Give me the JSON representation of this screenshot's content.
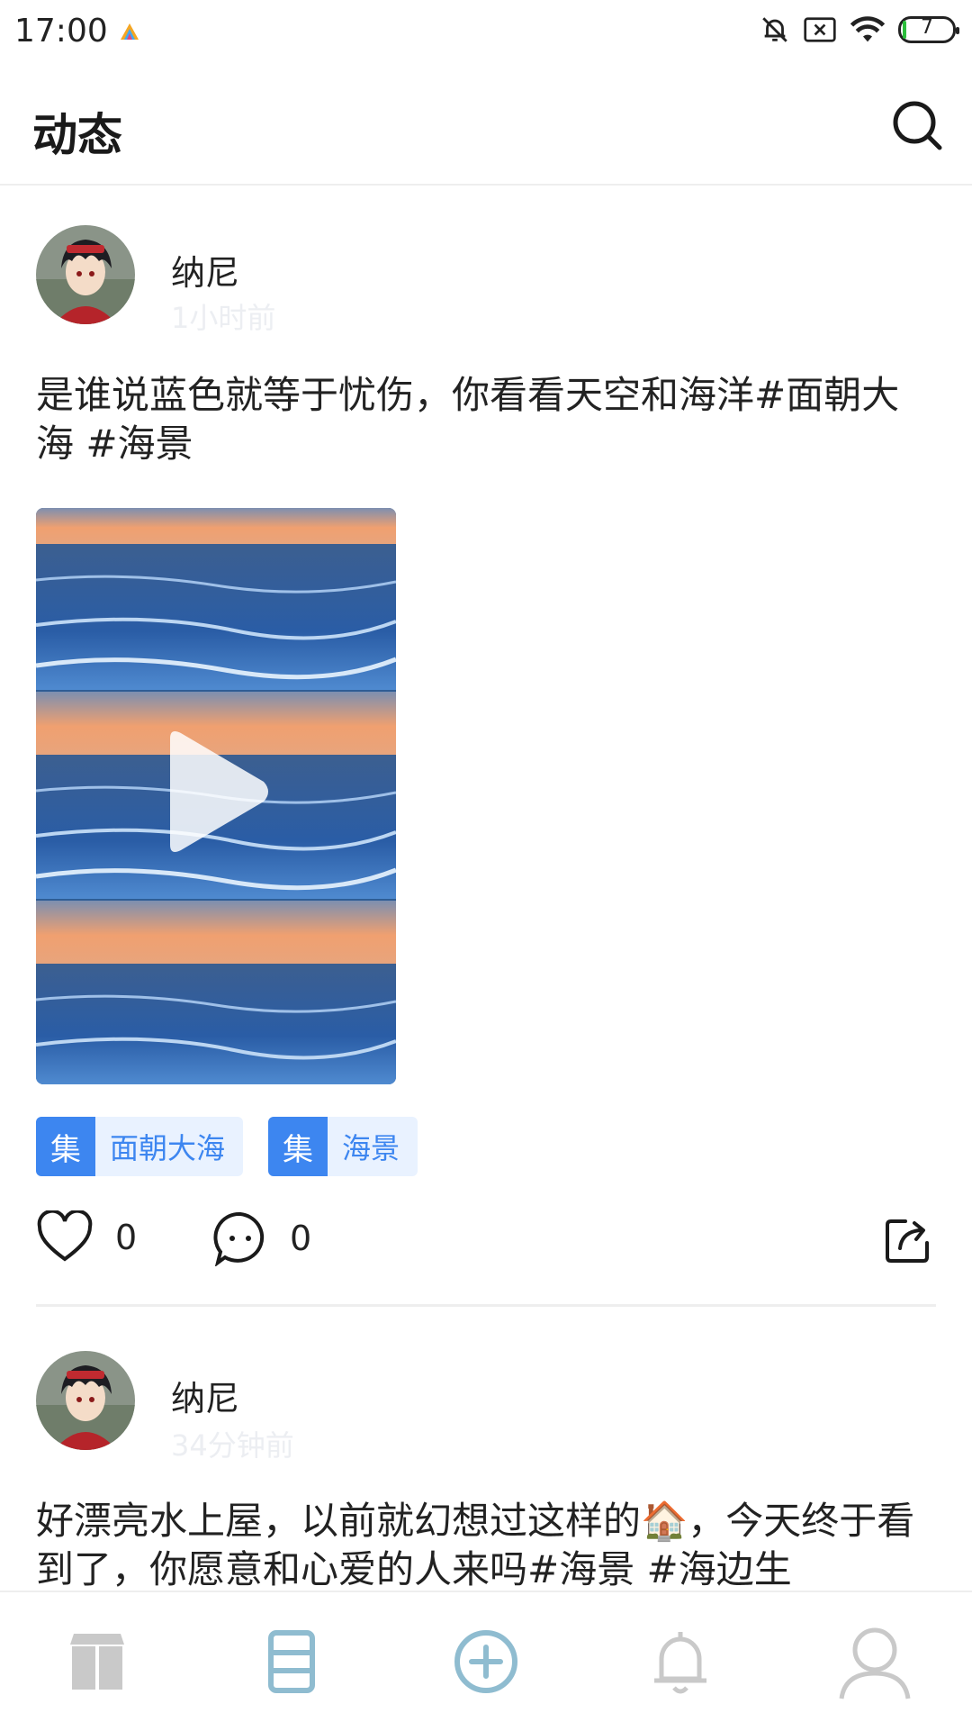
{
  "status_bar": {
    "time": "17:00",
    "battery_level": "7",
    "icons": [
      "app-icon",
      "bell-off-icon",
      "no-sim-icon",
      "wifi-icon",
      "battery-icon"
    ]
  },
  "header": {
    "title": "动态",
    "search_icon": "search-icon"
  },
  "posts": [
    {
      "username": "纳尼",
      "time": "1小时前",
      "text": "是谁说蓝色就等于忧伤，你看看天空和海洋#面朝大海 #海景",
      "media": "video",
      "tags": [
        {
          "badge": "集",
          "label": "面朝大海"
        },
        {
          "badge": "集",
          "label": "海景"
        }
      ],
      "likes": "0",
      "comments": "0"
    },
    {
      "username": "纳尼",
      "time": "34分钟前",
      "text": "好漂亮水上屋，以前就幻想过这样的🏠，今天终于看到了，你愿意和心爱的人来吗#海景 #海边生"
    }
  ],
  "bottom_nav": {
    "items": [
      "home-icon",
      "feed-icon",
      "add-icon",
      "notification-icon",
      "profile-icon"
    ],
    "active_index": 1
  },
  "colors": {
    "accent": "#3d86f0",
    "tag_bg": "#e9f2ff",
    "nav_active": "#8fbcd0",
    "nav_inactive": "#c9c9c9"
  }
}
